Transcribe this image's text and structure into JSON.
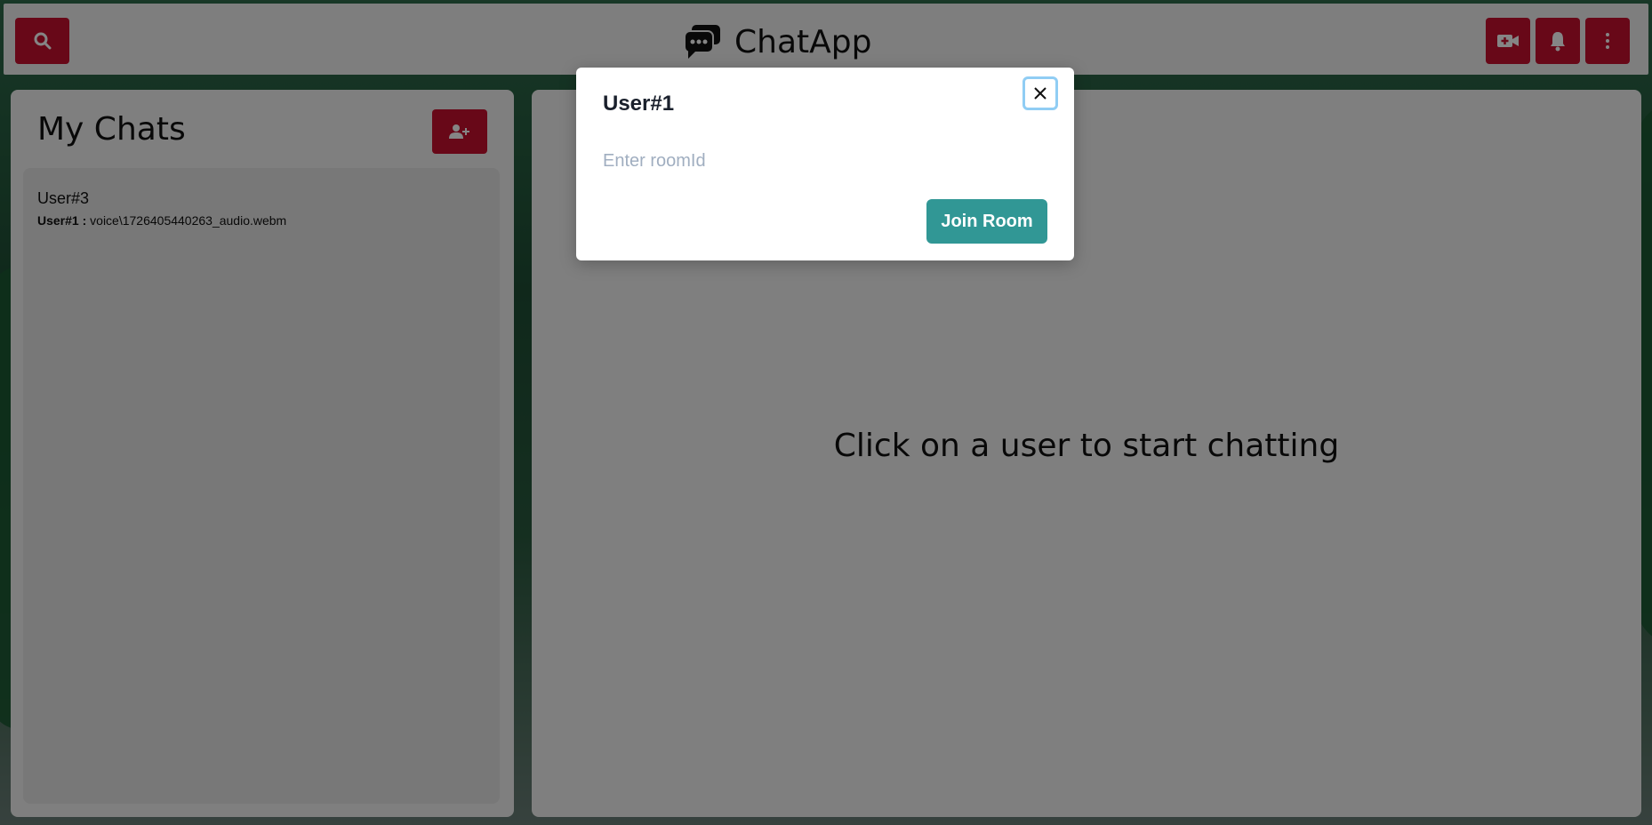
{
  "app": {
    "title": "ChatApp"
  },
  "header": {
    "icons": [
      "search-icon",
      "chat-bubble-icon",
      "video-plus-icon",
      "bell-icon",
      "vertical-dots-icon"
    ]
  },
  "sidebar": {
    "title": "My Chats",
    "add_icon": "add-user-icon",
    "chats": [
      {
        "name": "User#3",
        "sender": "User#1 :",
        "message": "voice\\1726405440263_audio.webm"
      }
    ]
  },
  "main": {
    "placeholder": "Click on a user to start chatting"
  },
  "modal": {
    "title": "User#1",
    "input": {
      "value": "",
      "placeholder": "Enter roomId"
    },
    "join_label": "Join Room",
    "close_icon": "close-icon"
  },
  "colors": {
    "accent_red": "#c8102e",
    "teal": "#319795",
    "focus_ring": "#90cdf4"
  }
}
